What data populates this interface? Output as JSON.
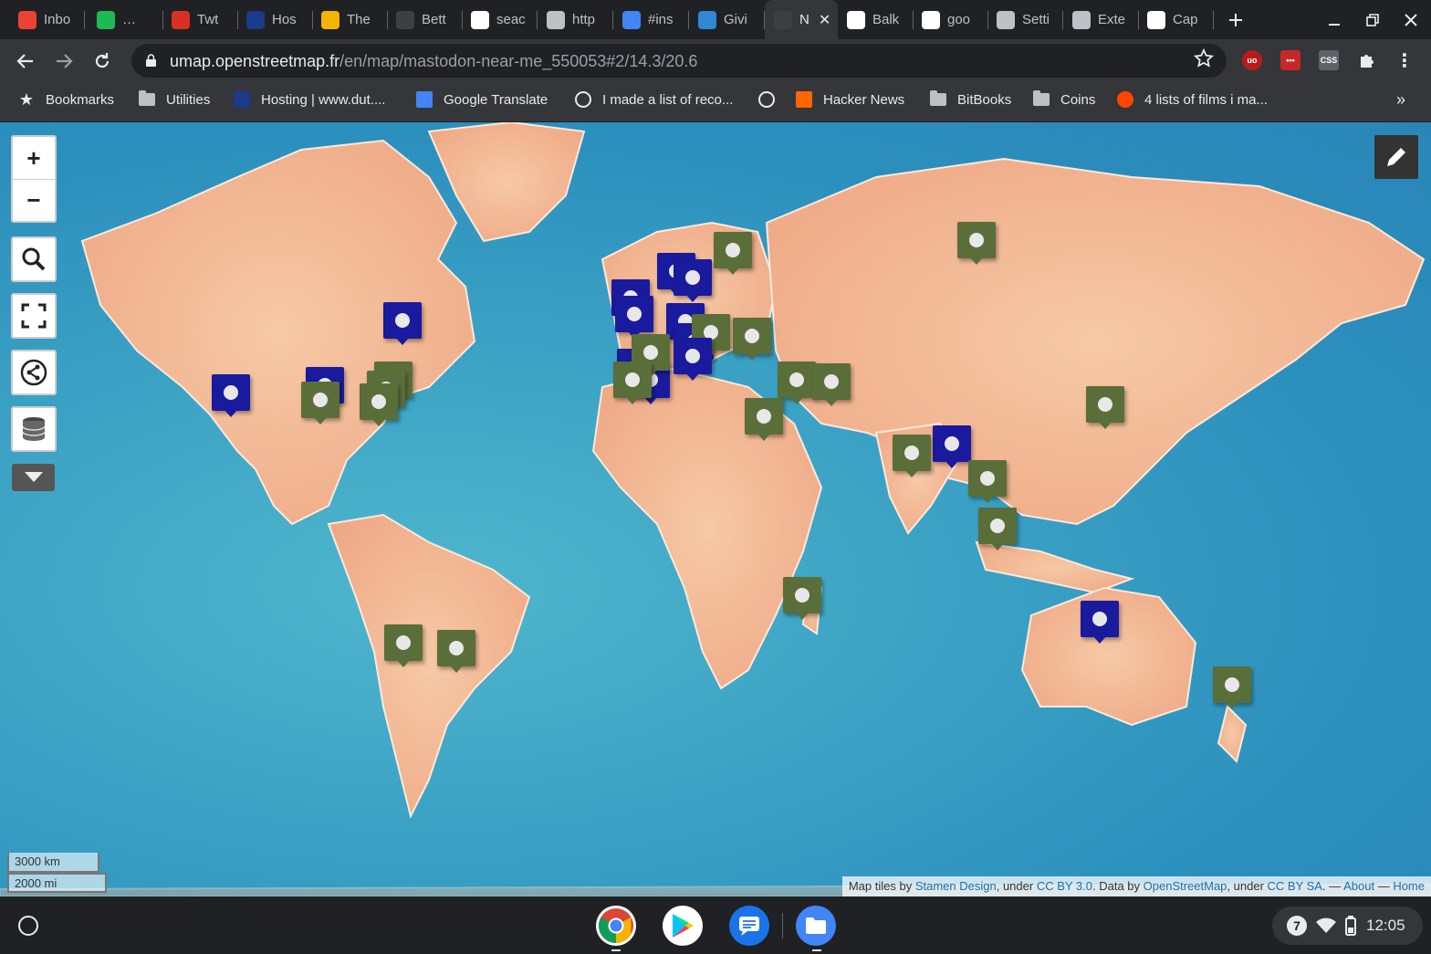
{
  "tabs": [
    {
      "label": "Inbo",
      "icon": "gmail-icon",
      "color": "#ea4335"
    },
    {
      "label": "…",
      "icon": "spotify-icon",
      "color": "#1db954"
    },
    {
      "label": "Twt",
      "icon": "twt-icon",
      "color": "#d93025"
    },
    {
      "label": "Hos",
      "icon": "d-icon",
      "color": "#1a3a8a"
    },
    {
      "label": "The",
      "icon": "f-icon",
      "color": "#f4b400"
    },
    {
      "label": "Bett",
      "icon": "page-icon",
      "color": "#3c4043"
    },
    {
      "label": "seac",
      "icon": "google-icon",
      "color": "#ffffff"
    },
    {
      "label": "http",
      "icon": "globe-icon",
      "color": "#bdc1c6"
    },
    {
      "label": "#ins",
      "icon": "photo-icon",
      "color": "#4285f4"
    },
    {
      "label": "Givi",
      "icon": "mastodon-icon",
      "color": "#3088d4"
    },
    {
      "label": "N",
      "icon": "umap-icon",
      "color": "#3c4043"
    },
    {
      "label": "Balk",
      "icon": "wikipedia-icon",
      "color": "#ffffff"
    },
    {
      "label": "goo",
      "icon": "google-icon",
      "color": "#ffffff"
    },
    {
      "label": "Setti",
      "icon": "gear-icon",
      "color": "#bdc1c6"
    },
    {
      "label": "Exte",
      "icon": "puzzle-icon",
      "color": "#bdc1c6"
    },
    {
      "label": "Cap",
      "icon": "google-icon",
      "color": "#ffffff"
    }
  ],
  "toolbar": {
    "url_host": "umap.openstreetmap.fr",
    "url_path": "/en/map/mastodon-near-me_550053#2/14.3/20.6"
  },
  "bookmarks": [
    {
      "label": "Bookmarks",
      "icon": "star-icon"
    },
    {
      "label": "Utilities",
      "icon": "folder-icon"
    },
    {
      "label": "Hosting | www.dut....",
      "icon": "d-icon"
    },
    {
      "label": "Google Translate",
      "icon": "translate-icon"
    },
    {
      "label": "I made a list of reco...",
      "icon": "globe-icon"
    },
    {
      "label": "",
      "icon": "globe-icon"
    },
    {
      "label": "Hacker News",
      "icon": "hn-icon"
    },
    {
      "label": "BitBooks",
      "icon": "folder-icon"
    },
    {
      "label": "Coins",
      "icon": "folder-icon"
    },
    {
      "label": "4 lists of films i ma...",
      "icon": "reddit-icon"
    }
  ],
  "map": {
    "scale_km": "3000 km",
    "scale_mi": "2000 mi",
    "attribution": {
      "prefix": "Map tiles by ",
      "stamen": "Stamen Design",
      "mid1": ", under ",
      "ccby": "CC BY 3.0",
      "mid2": ". Data by ",
      "osm": "OpenStreetMap",
      "mid3": ", under ",
      "ccbysa": "CC BY SA",
      "mid4": ". — ",
      "about": "About",
      "sep": " — ",
      "home": "Home"
    },
    "marker_colors": {
      "blue": "#1a1a9e",
      "green": "#5a6e3a"
    }
  },
  "shelf": {
    "notification_count": "7",
    "time": "12:05"
  }
}
